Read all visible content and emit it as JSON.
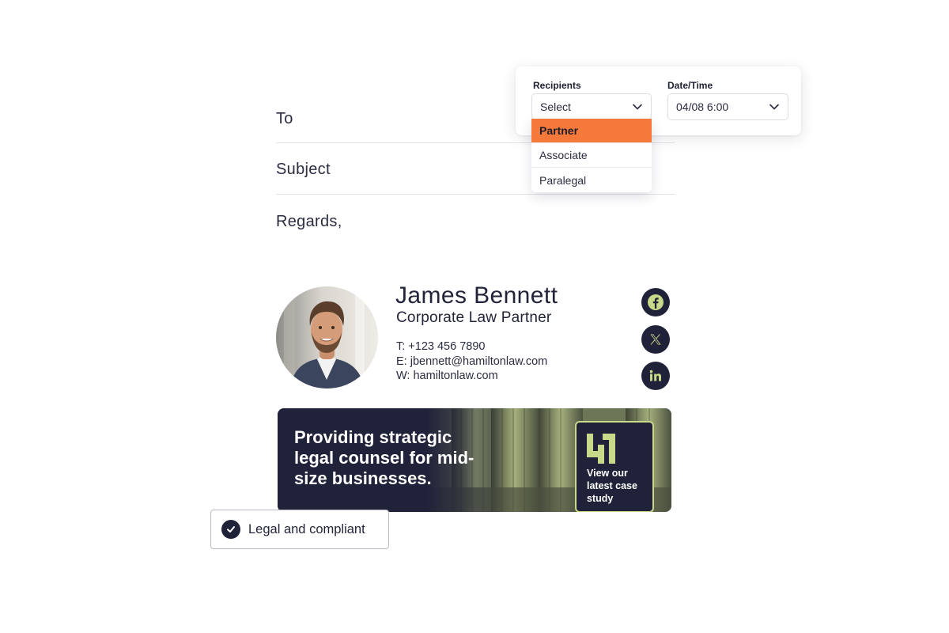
{
  "composer": {
    "to_label": "To",
    "subject_label": "Subject",
    "closing": "Regards,"
  },
  "filters": {
    "recipients_label": "Recipients",
    "recipients_value": "Select",
    "datetime_label": "Date/Time",
    "datetime_value": "04/08 6:00",
    "recipient_options": [
      "Partner",
      "Associate",
      "Paralegal"
    ],
    "highlighted_option": "Partner"
  },
  "signature": {
    "name": "James Bennett",
    "title": "Corporate Law Partner",
    "phone": "T: +123 456 7890",
    "email": "E: jbennett@hamiltonlaw.com",
    "website": "W: hamiltonlaw.com",
    "social_icons": [
      "facebook-icon",
      "x-icon",
      "linkedin-icon"
    ]
  },
  "banner": {
    "headline": "Providing strategic legal counsel for mid-size businesses.",
    "cta": "View our latest case study"
  },
  "badge": {
    "label": "Legal and compliant"
  },
  "colors": {
    "navy": "#20223a",
    "accent_orange": "#f4793a",
    "accent_lime": "#c9d98a"
  }
}
